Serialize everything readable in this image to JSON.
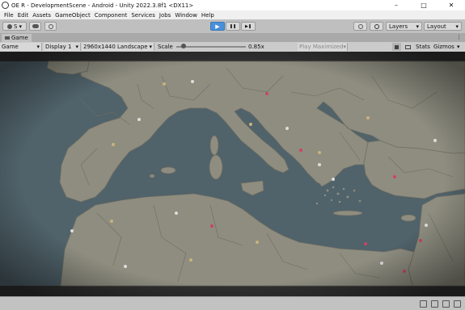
{
  "window": {
    "title": "OE R - DevelopmentScene - Android - Unity 2022.3.8f1 <DX11>",
    "minimize_glyph": "–",
    "maximize_glyph": "□",
    "close_glyph": "✕"
  },
  "menu": [
    "File",
    "Edit",
    "Assets",
    "GameObject",
    "Component",
    "Services",
    "Jobs",
    "Window",
    "Help"
  ],
  "toolbar": {
    "account_label": "S",
    "play_glyph": "▶",
    "pause_glyph": "❚❚",
    "step_glyph": "▶❚",
    "layers_label": "Layers",
    "layout_label": "Layout"
  },
  "tab": {
    "label": "Game"
  },
  "game_toolbar": {
    "mode": "Game",
    "display": "Display 1",
    "resolution": "2960x1440 Landscape",
    "scale_label": "Scale",
    "scale_value": "0.85x",
    "scale_level": 0.1,
    "play_maximized": "Play Maximized",
    "stats": "Stats",
    "gizmos": "Gizmos"
  },
  "colors": {
    "sea": "#50626a",
    "land": "#8e8d80",
    "border": "#6e6d62",
    "frame": "#2f2f2f"
  }
}
